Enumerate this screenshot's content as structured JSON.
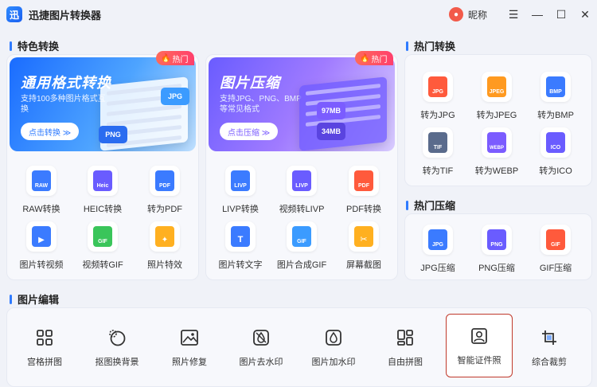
{
  "app": {
    "title": "迅捷图片转换器",
    "logo_glyph": "迅"
  },
  "titlebar": {
    "nickname": "昵称",
    "menu_glyph": "☰",
    "min_glyph": "—",
    "max_glyph": "☐",
    "close_glyph": "✕"
  },
  "sections": {
    "featured": "特色转换",
    "hot_convert": "热门转换",
    "hot_compress": "热门压缩",
    "edit": "图片编辑"
  },
  "banners": {
    "format": {
      "title": "通用格式转换",
      "desc": "支持100多种图片格式互换",
      "button": "点击转换 ≫",
      "tag": "热门",
      "chip1": "JPG",
      "chip2": "PNG"
    },
    "compress": {
      "title": "图片压缩",
      "desc": "支持JPG、PNG、BMP等常见格式",
      "button": "点击压缩 ≫",
      "tag": "热门",
      "chip1": "97MB",
      "chip2": "34MB"
    }
  },
  "featured_left": [
    {
      "label": "RAW转换",
      "badge": "RAW",
      "color": "#3b7bff"
    },
    {
      "label": "HEIC转换",
      "badge": "Heic",
      "color": "#6a5cff"
    },
    {
      "label": "转为PDF",
      "badge": "PDF",
      "color": "#3b7bff"
    },
    {
      "label": "图片转视频",
      "badge": "▶",
      "color": "#3b7bff"
    },
    {
      "label": "视频转GIF",
      "badge": "GIF",
      "color": "#3ac55a"
    },
    {
      "label": "照片特效",
      "badge": "✦",
      "color": "#ffb020"
    }
  ],
  "featured_right": [
    {
      "label": "LIVP转换",
      "badge": "LIVP",
      "color": "#3b7bff"
    },
    {
      "label": "视频转LIVP",
      "badge": "LIVP",
      "color": "#6a5cff"
    },
    {
      "label": "PDF转换",
      "badge": "PDF",
      "color": "#ff5a3c"
    },
    {
      "label": "图片转文字",
      "badge": "T",
      "color": "#3b7bff"
    },
    {
      "label": "图片合成GIF",
      "badge": "GIF",
      "color": "#3b9bff"
    },
    {
      "label": "屏幕截图",
      "badge": "✂",
      "color": "#ffb020"
    }
  ],
  "hot_convert": [
    {
      "label": "转为JPG",
      "badge": "JPG",
      "color": "#ff5a3c"
    },
    {
      "label": "转为JPEG",
      "badge": "JPEG",
      "color": "#ff9a20"
    },
    {
      "label": "转为BMP",
      "badge": "BMP",
      "color": "#3b7bff"
    },
    {
      "label": "转为TIF",
      "badge": "TIF",
      "color": "#5a6b8c"
    },
    {
      "label": "转为WEBP",
      "badge": "WEBP",
      "color": "#7b5cff"
    },
    {
      "label": "转为ICO",
      "badge": "ICO",
      "color": "#6a5cff"
    }
  ],
  "hot_compress": [
    {
      "label": "JPG压缩",
      "badge": "JPG",
      "color": "#3b7bff"
    },
    {
      "label": "PNG压缩",
      "badge": "PNG",
      "color": "#6a5cff"
    },
    {
      "label": "GIF压缩",
      "badge": "GIF",
      "color": "#ff5a3c"
    }
  ],
  "edit_tools": [
    {
      "label": "宫格拼图",
      "icon": "grid-icon"
    },
    {
      "label": "抠图换背景",
      "icon": "cutout-icon"
    },
    {
      "label": "照片修复",
      "icon": "photo-repair-icon"
    },
    {
      "label": "图片去水印",
      "icon": "remove-watermark-icon"
    },
    {
      "label": "图片加水印",
      "icon": "add-watermark-icon"
    },
    {
      "label": "自由拼图",
      "icon": "free-collage-icon"
    },
    {
      "label": "智能证件照",
      "icon": "id-photo-icon"
    },
    {
      "label": "综合裁剪",
      "icon": "crop-icon"
    }
  ],
  "colors": {
    "accent": "#2f7bff",
    "hot": "#ff3f6c",
    "selected_border": "#c0392b"
  }
}
